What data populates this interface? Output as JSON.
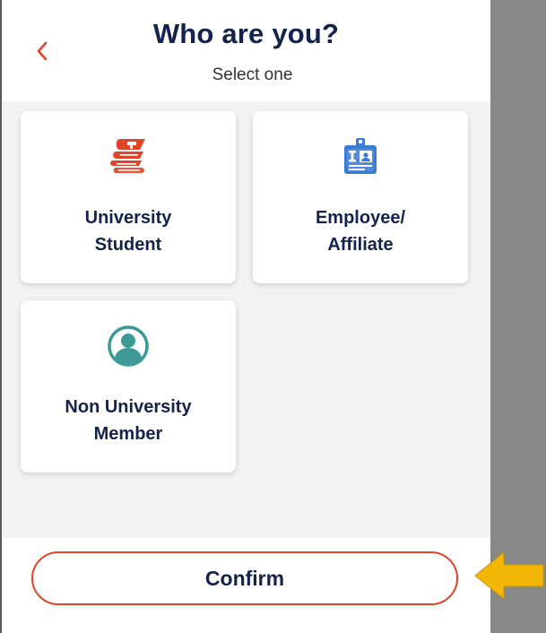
{
  "header": {
    "title": "Who are you?",
    "subtitle": "Select one",
    "back_icon": "chevron-left-icon"
  },
  "options": [
    {
      "line1": "University",
      "line2": "Student",
      "icon": "books-icon",
      "icon_color": "#e0452a"
    },
    {
      "line1": "Employee/",
      "line2": "Affiliate",
      "icon": "id-badge-icon",
      "icon_color": "#3a7bd5"
    },
    {
      "line1": "Non University",
      "line2": "Member",
      "icon": "user-circle-icon",
      "icon_color": "#3d9a96"
    }
  ],
  "footer": {
    "confirm_label": "Confirm"
  },
  "colors": {
    "accent": "#e0452a",
    "text_dark": "#14234b",
    "annotation_arrow": "#f2b705"
  }
}
